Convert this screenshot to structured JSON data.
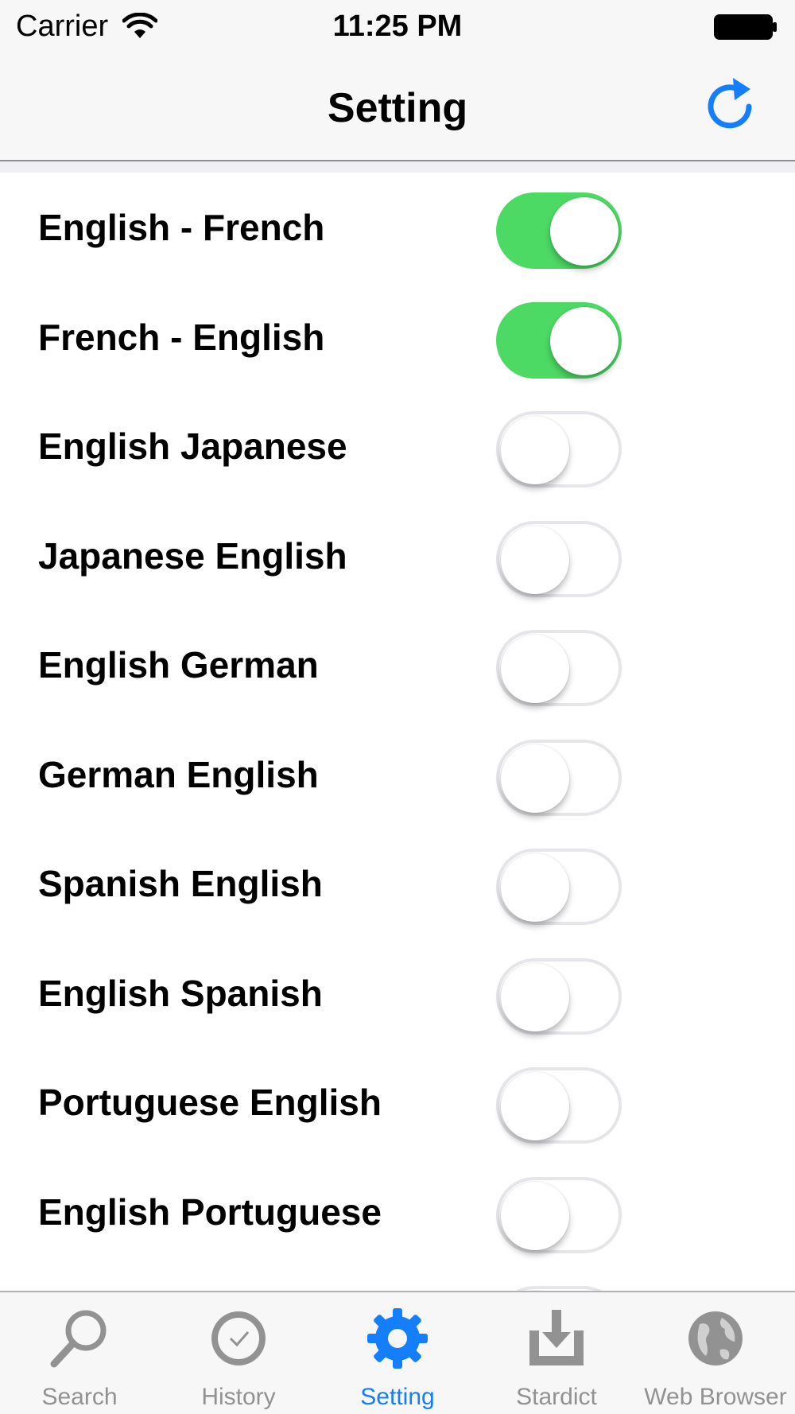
{
  "colors": {
    "accent": "#147efb",
    "toggle_on": "#4cd964",
    "inactive_tab": "#929292"
  },
  "status_bar": {
    "carrier": "Carrier",
    "time": "11:25 PM"
  },
  "nav": {
    "title": "Setting",
    "right_icon": "refresh-icon"
  },
  "dictionaries": [
    {
      "label": "English - French",
      "enabled": true
    },
    {
      "label": "French - English",
      "enabled": true
    },
    {
      "label": "English Japanese",
      "enabled": false
    },
    {
      "label": "Japanese English",
      "enabled": false
    },
    {
      "label": "English German",
      "enabled": false
    },
    {
      "label": "German English",
      "enabled": false
    },
    {
      "label": "Spanish English",
      "enabled": false
    },
    {
      "label": "English Spanish",
      "enabled": false
    },
    {
      "label": "Portuguese English",
      "enabled": false
    },
    {
      "label": "English Portuguese",
      "enabled": false
    }
  ],
  "tab_bar": {
    "tabs": [
      {
        "label": "Search",
        "icon": "search-icon",
        "active": false
      },
      {
        "label": "History",
        "icon": "history-icon",
        "active": false
      },
      {
        "label": "Setting",
        "icon": "gear-icon",
        "active": true
      },
      {
        "label": "Stardict",
        "icon": "download-icon",
        "active": false
      },
      {
        "label": "Web Browser",
        "icon": "globe-icon",
        "active": false
      }
    ]
  }
}
